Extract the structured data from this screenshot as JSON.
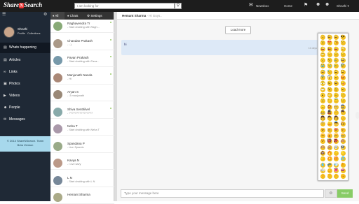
{
  "topbar": {
    "brand_pre": "Share",
    "brand_n": "N",
    "brand_post": "Search",
    "search_placeholder": "I am looking for",
    "nav": {
      "newsbox": "Newsbox",
      "home": "Home",
      "user": "Shruthi"
    }
  },
  "sidebar": {
    "profile_name": "Shruthi",
    "profile_link": "Profile",
    "collections_link": "Collections",
    "items": [
      {
        "label": "Whats happening",
        "icon": "newspaper-icon"
      },
      {
        "label": "Articles",
        "icon": "document-icon"
      },
      {
        "label": "Links",
        "icon": "link-icon"
      },
      {
        "label": "Photos",
        "icon": "photo-icon"
      },
      {
        "label": "Videos",
        "icon": "video-icon"
      },
      {
        "label": "People",
        "icon": "people-icon"
      },
      {
        "label": "Messages",
        "icon": "envelope-icon"
      }
    ],
    "copyright": "© 2014 ShareNSearch. Team",
    "version": "Beta Version"
  },
  "tabs": {
    "all": "All",
    "chats": "Chats",
    "settings": "Settings"
  },
  "contacts": [
    {
      "name": "Raghavendra Tr",
      "msg": "- Start chatting with Ragh...",
      "online": true
    },
    {
      "name": "Chandan Prakash",
      "msg": "- :-)",
      "online": true
    },
    {
      "name": "Pavan Prakash",
      "msg": "- Start chatting with Pava...",
      "online": true
    },
    {
      "name": "Manjunath Nanda",
      "msg": "- Hi",
      "online": true
    },
    {
      "name": "Aryan S",
      "msg": "- :3 manjunath",
      "online": false
    },
    {
      "name": "Shiva Senthilvel",
      "msg": "- ????????????????",
      "online": true
    },
    {
      "name": "Neha T",
      "msg": "- Start chatting with Neha T",
      "online": false
    },
    {
      "name": "Spandana P",
      "msg": "- Lion Spando",
      "online": false
    },
    {
      "name": "Kavya N",
      "msg": "- I ove kavy",
      "online": false
    },
    {
      "name": "L N",
      "msg": "- Start chatting with L N",
      "online": false
    },
    {
      "name": "Hemant Sharma",
      "msg": "",
      "online": false
    }
  ],
  "chat": {
    "header_name": "Hemant Sharma",
    "header_sep": " - ",
    "header_status": "Hi Guys..",
    "load_more": "Load more",
    "message_text": "hi",
    "message_time": "16 days",
    "input_placeholder": "Type your message here",
    "send_label": "Send"
  },
  "emoji_panel": {
    "emojis": [
      "😊",
      "😃",
      "😄",
      "😎",
      "😉",
      "😍",
      "😘",
      "😚",
      "😜",
      "😝",
      "😛",
      "😳",
      "😁",
      "😔",
      "😌",
      "😒",
      "😞",
      "😣",
      "😢",
      "😂",
      "😭",
      "😪",
      "😥",
      "😰",
      "😅",
      "😓",
      "😩",
      "😫",
      "😨",
      "😱",
      "😠",
      "😡",
      "😤",
      "😖",
      "😆",
      "😋",
      "😷",
      "😵",
      "😲",
      "😦",
      "😮",
      "😬",
      "😐",
      "😕",
      "😯",
      "😶",
      "😇",
      "😏",
      "😑",
      "👲",
      "👳",
      "👮",
      "👷",
      "💂",
      "👶",
      "👦",
      "👧",
      "👨",
      "👩",
      "👴",
      "👵",
      "👱",
      "👼",
      "👸",
      "😺",
      "😸",
      "😻",
      "😽",
      "😼",
      "🙀",
      "😿",
      "😹",
      "😾",
      "👹",
      "👺",
      "🙈",
      "🙉",
      "🙊",
      "💀",
      "👽",
      "💩",
      "🔥",
      "✨",
      "🌟",
      "💫",
      "💥",
      "💢",
      "💦",
      "💧",
      "💤",
      "💨",
      "👂",
      "👀",
      "👃",
      "👅",
      "👄",
      "👍",
      "👎",
      "👌",
      "👊"
    ]
  },
  "colors": {
    "topbar": "#1d1d1d",
    "sidebar": "#1f2936",
    "accent_send": "#88cc66",
    "message_bubble": "#dde9f7",
    "copyright_bg": "#a7d8ec"
  }
}
